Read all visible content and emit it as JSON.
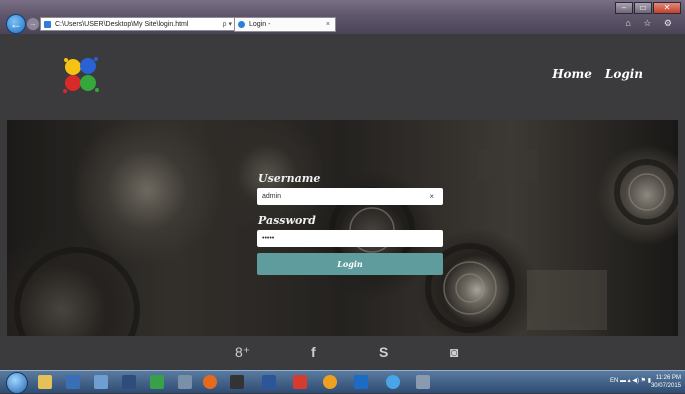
{
  "browser": {
    "address": "C:\\Users\\USER\\Desktop\\My Site\\login.html",
    "address_tools": "ρ ▾ C",
    "tab_title": "Login -",
    "tab_close": "×",
    "window_buttons": [
      "–",
      "▭",
      "✕"
    ],
    "chrome_icons": "⌂ ☆ ⚙"
  },
  "nav": {
    "home": "Home",
    "login": "Login"
  },
  "form": {
    "username_label": "Username",
    "username_value": "admin",
    "clear_symbol": "×",
    "password_label": "Password",
    "password_value": "•••••",
    "submit_label": "Login"
  },
  "footer": {
    "google": "8⁺",
    "facebook": "f",
    "skype": "S",
    "instagram": "◙"
  },
  "taskbar": {
    "tray": "EN ▬ ▴ ◀) ⚑ ▮",
    "time": "11:26 PM",
    "date": "30/07/2015"
  }
}
